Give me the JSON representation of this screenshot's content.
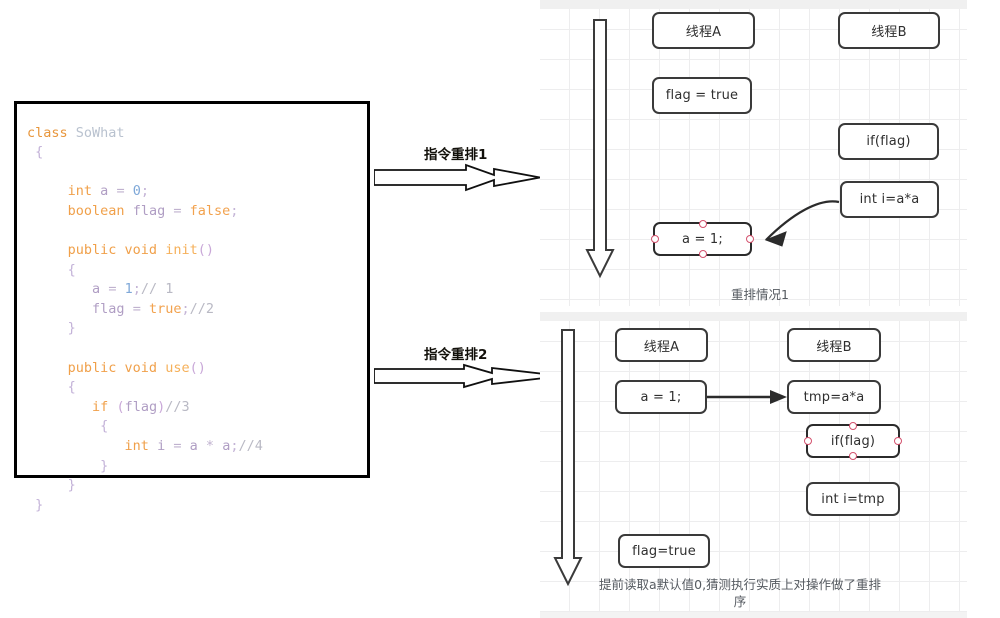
{
  "code_panel": {
    "lines": [
      [
        {
          "t": "class ",
          "c": "kw"
        },
        {
          "t": "SoWhat",
          "c": "cls"
        }
      ],
      [
        {
          "t": " {",
          "c": "brace"
        }
      ],
      [
        {
          "t": "",
          "c": "plain"
        }
      ],
      [
        {
          "t": "     ",
          "c": "plain"
        },
        {
          "t": "int",
          "c": "type"
        },
        {
          "t": " ",
          "c": "plain"
        },
        {
          "t": "a",
          "c": "var"
        },
        {
          "t": " ",
          "c": "plain"
        },
        {
          "t": "=",
          "c": "op"
        },
        {
          "t": " ",
          "c": "plain"
        },
        {
          "t": "0",
          "c": "num"
        },
        {
          "t": ";",
          "c": "punc"
        }
      ],
      [
        {
          "t": "     ",
          "c": "plain"
        },
        {
          "t": "boolean",
          "c": "type"
        },
        {
          "t": " ",
          "c": "plain"
        },
        {
          "t": "flag",
          "c": "var"
        },
        {
          "t": " ",
          "c": "plain"
        },
        {
          "t": "=",
          "c": "op"
        },
        {
          "t": " ",
          "c": "plain"
        },
        {
          "t": "false",
          "c": "bool"
        },
        {
          "t": ";",
          "c": "punc"
        }
      ],
      [
        {
          "t": "",
          "c": "plain"
        }
      ],
      [
        {
          "t": "     ",
          "c": "plain"
        },
        {
          "t": "public void ",
          "c": "type"
        },
        {
          "t": "init",
          "c": "fn"
        },
        {
          "t": "()",
          "c": "paren"
        }
      ],
      [
        {
          "t": "     ",
          "c": "plain"
        },
        {
          "t": "{",
          "c": "brace"
        }
      ],
      [
        {
          "t": "        ",
          "c": "plain"
        },
        {
          "t": "a",
          "c": "var"
        },
        {
          "t": " ",
          "c": "plain"
        },
        {
          "t": "=",
          "c": "op"
        },
        {
          "t": " ",
          "c": "plain"
        },
        {
          "t": "1",
          "c": "num"
        },
        {
          "t": ";",
          "c": "punc"
        },
        {
          "t": "// 1",
          "c": "cmt"
        }
      ],
      [
        {
          "t": "        ",
          "c": "plain"
        },
        {
          "t": "flag",
          "c": "var"
        },
        {
          "t": " ",
          "c": "plain"
        },
        {
          "t": "=",
          "c": "op"
        },
        {
          "t": " ",
          "c": "plain"
        },
        {
          "t": "true",
          "c": "bool"
        },
        {
          "t": ";",
          "c": "punc"
        },
        {
          "t": "//2",
          "c": "cmt"
        }
      ],
      [
        {
          "t": "     ",
          "c": "plain"
        },
        {
          "t": "}",
          "c": "brace"
        }
      ],
      [
        {
          "t": "",
          "c": "plain"
        }
      ],
      [
        {
          "t": "     ",
          "c": "plain"
        },
        {
          "t": "public void ",
          "c": "type"
        },
        {
          "t": "use",
          "c": "fn"
        },
        {
          "t": "()",
          "c": "paren"
        }
      ],
      [
        {
          "t": "     ",
          "c": "plain"
        },
        {
          "t": "{",
          "c": "brace"
        }
      ],
      [
        {
          "t": "        ",
          "c": "plain"
        },
        {
          "t": "if",
          "c": "type"
        },
        {
          "t": " ",
          "c": "plain"
        },
        {
          "t": "(",
          "c": "paren"
        },
        {
          "t": "flag",
          "c": "var"
        },
        {
          "t": ")",
          "c": "paren"
        },
        {
          "t": "//3",
          "c": "cmt"
        }
      ],
      [
        {
          "t": "         ",
          "c": "plain"
        },
        {
          "t": "{",
          "c": "brace"
        }
      ],
      [
        {
          "t": "            ",
          "c": "plain"
        },
        {
          "t": "int",
          "c": "type"
        },
        {
          "t": " ",
          "c": "plain"
        },
        {
          "t": "i",
          "c": "var"
        },
        {
          "t": " ",
          "c": "plain"
        },
        {
          "t": "=",
          "c": "op"
        },
        {
          "t": " ",
          "c": "plain"
        },
        {
          "t": "a",
          "c": "var"
        },
        {
          "t": " ",
          "c": "plain"
        },
        {
          "t": "*",
          "c": "op"
        },
        {
          "t": " ",
          "c": "plain"
        },
        {
          "t": "a",
          "c": "var"
        },
        {
          "t": ";",
          "c": "punc"
        },
        {
          "t": "//4",
          "c": "cmt"
        }
      ],
      [
        {
          "t": "         ",
          "c": "plain"
        },
        {
          "t": "}",
          "c": "brace"
        }
      ],
      [
        {
          "t": "     ",
          "c": "plain"
        },
        {
          "t": "}",
          "c": "brace"
        }
      ],
      [
        {
          "t": " }",
          "c": "brace"
        }
      ]
    ]
  },
  "arrows": {
    "arrow1_label": "指令重排1",
    "arrow2_label": "指令重排2"
  },
  "diagram1": {
    "caption": "重排情况1",
    "nodes": [
      {
        "id": "thread-a-header",
        "label": "线程A",
        "selected": false
      },
      {
        "id": "thread-b-header",
        "label": "线程B",
        "selected": false
      },
      {
        "id": "flag-true",
        "label": "flag = true",
        "selected": false
      },
      {
        "id": "if-flag",
        "label": "if(flag)",
        "selected": false
      },
      {
        "id": "int-i-aa",
        "label": "int i=a*a",
        "selected": false
      },
      {
        "id": "a-assign-1",
        "label": "a = 1;",
        "selected": true
      }
    ]
  },
  "diagram2": {
    "caption": "提前读取a默认值0,猜测执行实质上对操作做了重排序",
    "nodes": [
      {
        "id": "thread-a-header",
        "label": "线程A",
        "selected": false
      },
      {
        "id": "thread-b-header",
        "label": "线程B",
        "selected": false
      },
      {
        "id": "a-assign-1",
        "label": "a = 1;",
        "selected": false
      },
      {
        "id": "tmp-aa",
        "label": "tmp=a*a",
        "selected": false
      },
      {
        "id": "if-flag",
        "label": "if(flag)",
        "selected": true
      },
      {
        "id": "int-i-tmp",
        "label": "int i=tmp",
        "selected": false
      },
      {
        "id": "flag-true",
        "label": "flag=true",
        "selected": false
      }
    ]
  },
  "colors": {
    "panel_border": "#000000",
    "node_border": "#3a3a3a",
    "handle_stroke": "#d4526e",
    "grid_line": "#ededee",
    "caption_text": "#555a60",
    "keyword": "#e8963c",
    "class_name": "#b9c2cf",
    "variable": "#b09ec4",
    "number": "#7fa8d8",
    "comment": "#b9b9c4"
  }
}
